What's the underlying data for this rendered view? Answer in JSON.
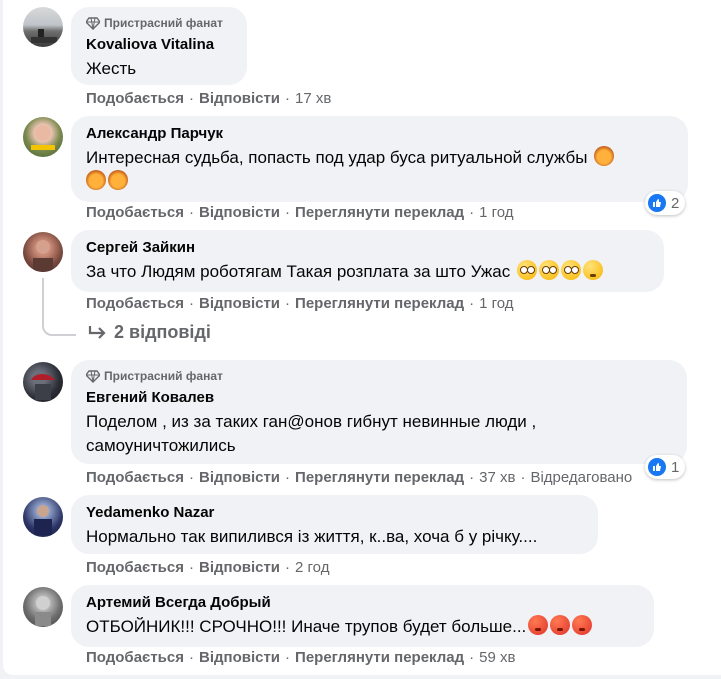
{
  "badge_label": "Пристрасний фанат",
  "actions": {
    "like": "Подобається",
    "reply": "Відповісти",
    "translate": "Переглянути переклад",
    "edited": "Відредаговано"
  },
  "comments": [
    {
      "author": "Kovaliova Vitalina",
      "text": "Жесть",
      "time": "17 хв",
      "badge": true
    },
    {
      "author": "Александр Парчук",
      "text_line1": "Интересная судьба, попасть под удар буса ритуальной службы",
      "time": "1 год",
      "reactions": "2",
      "emoji": "lion"
    },
    {
      "author": "Сергей Зайкин",
      "text": "За что Людям роботягам Такая розплата за што Ужас",
      "time": "1 год",
      "emoji": "flushed-worried"
    },
    {
      "author": "Евгений Ковалев",
      "text_line1": "Поделом , из за таких ган@онов гибнут невинные люди ,",
      "text_line2": "самоуничтожились",
      "time": "37 хв",
      "reactions": "1",
      "badge": true
    },
    {
      "author": "Yedamenko Nazar",
      "text": "Нормально так випилився із життя, к..ва, хоча б у річку....",
      "time": "2 год"
    },
    {
      "author": "Артемий Всегда Добрый",
      "text": "ОТБОЙНИК!!! СРОЧНО!!! Иначе трупов будет больше...",
      "time": "59 хв",
      "emoji": "angry"
    }
  ],
  "replies_link": "2 відповіді",
  "colors": {
    "like_blue": "#1877f2",
    "bubble": "#f0f2f5",
    "secondary_text": "#65676b"
  }
}
